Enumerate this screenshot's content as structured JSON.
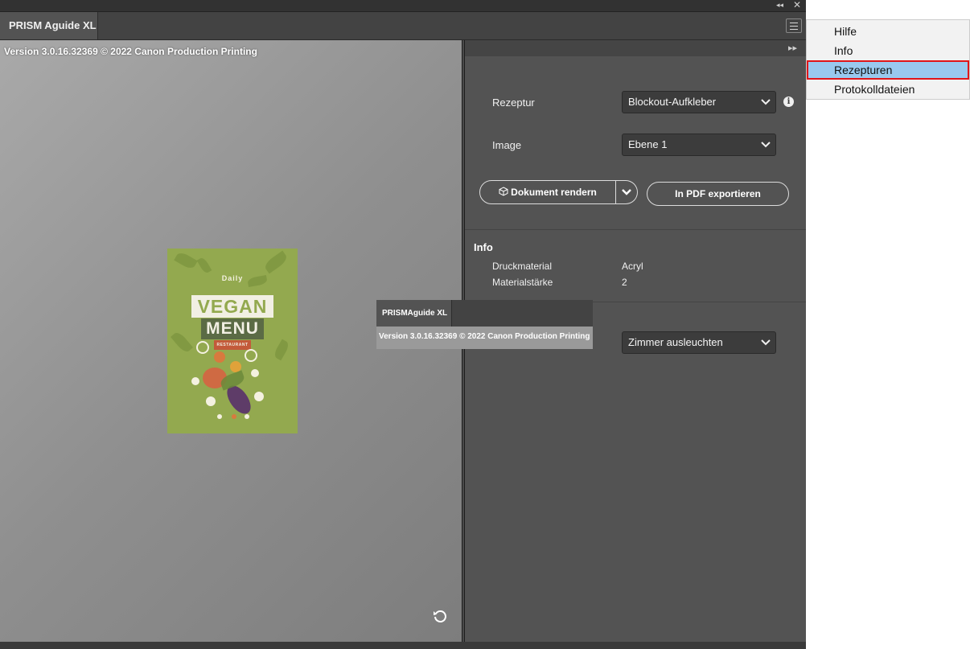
{
  "panel": {
    "tab_title": "PRISM Aguide XL",
    "version_text": "Version 3.0.16.32369 © 2022 Canon Production Printing",
    "window_controls": [
      "collapse-icon",
      "close-icon"
    ]
  },
  "preview": {
    "poster": {
      "small_text": "Daily",
      "headline1": "VEGAN",
      "headline2": "MENU",
      "tag": "RESTAURANT"
    }
  },
  "settings": {
    "rezeptur_label": "Rezeptur",
    "rezeptur_value": "Blockout-Aufkleber",
    "image_label": "Image",
    "image_value": "Ebene 1",
    "render_button": "Dokument rendern",
    "export_button": "In PDF exportieren"
  },
  "info": {
    "title": "Info",
    "rows": [
      {
        "label": "Druckmaterial",
        "value": "Acryl"
      },
      {
        "label": "Materialstärke",
        "value": "2"
      }
    ]
  },
  "lighting": {
    "value": "Zimmer ausleuchten"
  },
  "drag_ghost": {
    "tab_title": "PRISMAguide XL",
    "version_text": "Version 3.0.16.32369 © 2022 Canon Production Printing"
  },
  "flyout_menu": {
    "items": [
      "Hilfe",
      "Info",
      "Rezepturen",
      "Protokolldateien"
    ],
    "selected": "Rezepturen"
  }
}
